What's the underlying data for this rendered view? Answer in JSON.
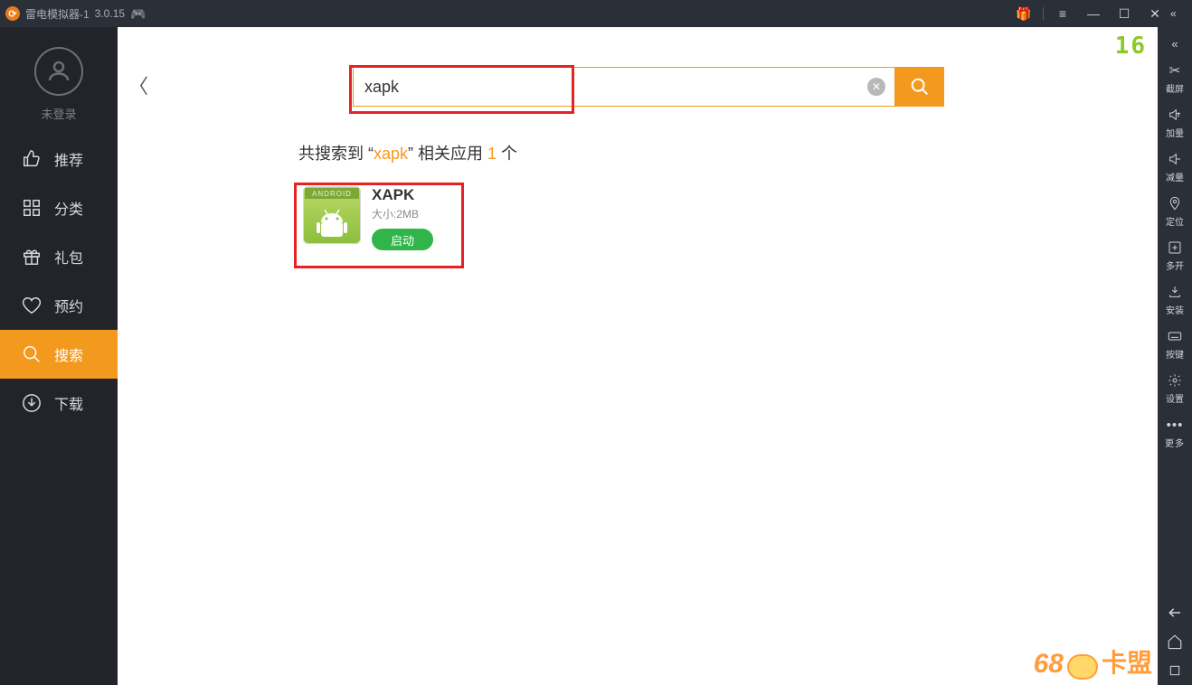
{
  "titlebar": {
    "title": "雷电模拟器-1",
    "version": "3.0.15"
  },
  "sidebar": {
    "login_label": "未登录",
    "items": [
      {
        "label": "推荐"
      },
      {
        "label": "分类"
      },
      {
        "label": "礼包"
      },
      {
        "label": "预约"
      },
      {
        "label": "搜索"
      },
      {
        "label": "下载"
      }
    ]
  },
  "search": {
    "value": "xapk",
    "placeholder": ""
  },
  "results": {
    "prefix": "共搜索到 “",
    "keyword": "xapk",
    "mid": "” 相关应用 ",
    "count": "1",
    "suffix": " 个"
  },
  "app": {
    "name": "XAPK",
    "size_label": "大小:2MB",
    "launch_label": "启动",
    "icon_tag": "ANDROID"
  },
  "corner_badge": "16",
  "rightbar": {
    "items": [
      {
        "label": "截屏"
      },
      {
        "label": "加量"
      },
      {
        "label": "减量"
      },
      {
        "label": "定位"
      },
      {
        "label": "多开"
      },
      {
        "label": "安装"
      },
      {
        "label": "按键"
      },
      {
        "label": "设置"
      }
    ],
    "more_label": "更多"
  },
  "watermark": {
    "num": "68",
    "txt": "卡盟"
  }
}
